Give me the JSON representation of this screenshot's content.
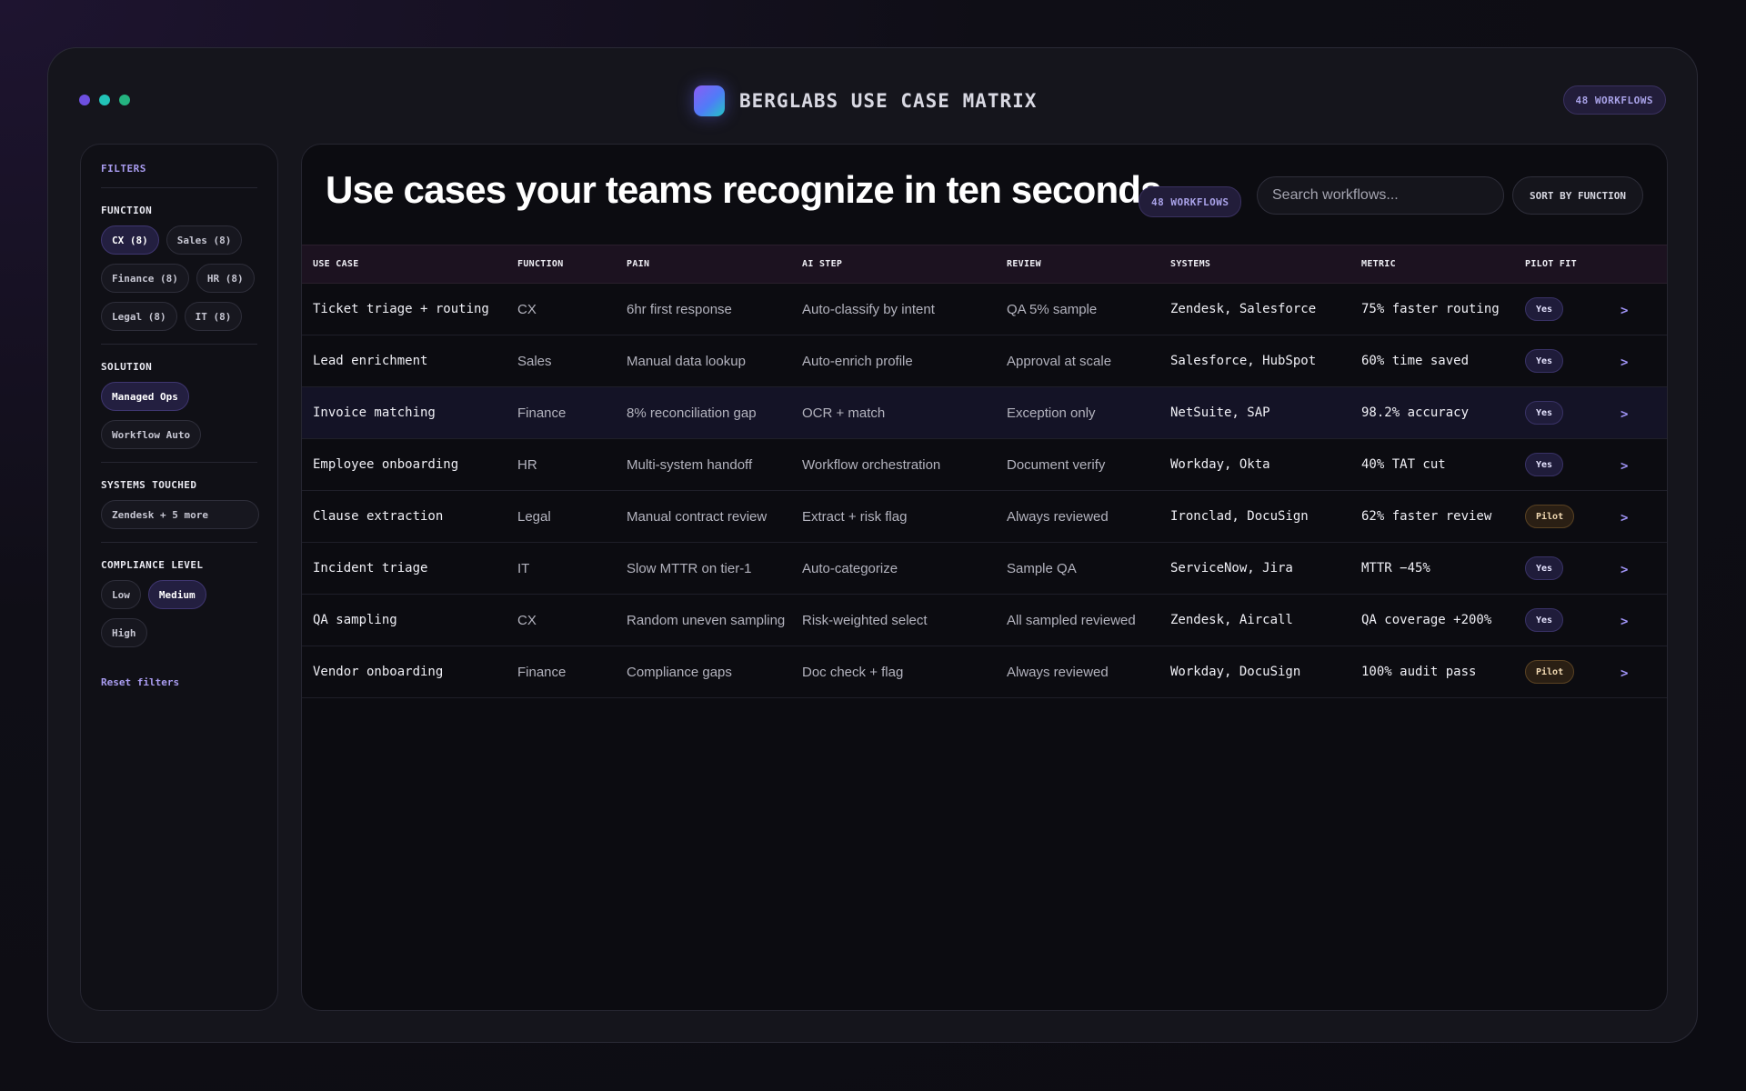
{
  "window": {
    "dots": [
      {
        "name": "window-dot-purple",
        "color": "#6d4fe0"
      },
      {
        "name": "window-dot-teal",
        "color": "#22c3b8"
      },
      {
        "name": "window-dot-green",
        "color": "#24b380"
      }
    ],
    "title": "BERGLABS USE CASE MATRIX",
    "workflow_badge": "48 WORKFLOWS"
  },
  "sidebar": {
    "heading": "FILTERS",
    "sections": {
      "function": {
        "title": "FUNCTION",
        "chips": [
          {
            "label": "CX (8)",
            "active": true
          },
          {
            "label": "Sales (8)",
            "active": false
          },
          {
            "label": "Finance (8)",
            "active": false
          },
          {
            "label": "HR (8)",
            "active": false
          },
          {
            "label": "Legal (8)",
            "active": false
          },
          {
            "label": "IT (8)",
            "active": false
          }
        ]
      },
      "solution": {
        "title": "SOLUTION",
        "chips": [
          {
            "label": "Managed Ops",
            "active": true
          },
          {
            "label": "Workflow Auto",
            "active": false
          }
        ]
      },
      "systems": {
        "title": "SYSTEMS TOUCHED",
        "select_value": "Zendesk + 5 more"
      },
      "compliance": {
        "title": "COMPLIANCE LEVEL",
        "chips": [
          {
            "label": "Low",
            "active": false
          },
          {
            "label": "Medium",
            "active": true
          },
          {
            "label": "High",
            "active": false
          }
        ]
      }
    },
    "reset_label": "Reset filters"
  },
  "main": {
    "headline": "Use cases your teams recognize in ten seconds.",
    "count_badge": "48 WORKFLOWS",
    "search_placeholder": "Search workflows...",
    "sort_label": "SORT BY FUNCTION",
    "columns": [
      "USE CASE",
      "FUNCTION",
      "PAIN",
      "AI STEP",
      "REVIEW",
      "SYSTEMS",
      "METRIC",
      "PILOT FIT"
    ],
    "rows": [
      {
        "use_case": "Ticket triage + routing",
        "function": "CX",
        "pain": "6hr first response",
        "ai_step": "Auto-classify by intent",
        "review": "QA 5% sample",
        "systems": "Zendesk, Salesforce",
        "metric": "75% faster routing",
        "fit": "Yes",
        "arrow": ">"
      },
      {
        "use_case": "Lead enrichment",
        "function": "Sales",
        "pain": "Manual data lookup",
        "ai_step": "Auto-enrich profile",
        "review": "Approval at scale",
        "systems": "Salesforce, HubSpot",
        "metric": "60% time saved",
        "fit": "Yes",
        "arrow": ">"
      },
      {
        "use_case": "Invoice matching",
        "function": "Finance",
        "pain": "8% reconciliation gap",
        "ai_step": "OCR + match",
        "review": "Exception only",
        "systems": "NetSuite, SAP",
        "metric": "98.2% accuracy",
        "fit": "Yes",
        "arrow": ">",
        "highlighted": true
      },
      {
        "use_case": "Employee onboarding",
        "function": "HR",
        "pain": "Multi-system handoff",
        "ai_step": "Workflow orchestration",
        "review": "Document verify",
        "systems": "Workday, Okta",
        "metric": "40% TAT cut",
        "fit": "Yes",
        "arrow": ">"
      },
      {
        "use_case": "Clause extraction",
        "function": "Legal",
        "pain": "Manual contract review",
        "ai_step": "Extract + risk flag",
        "review": "Always reviewed",
        "systems": "Ironclad, DocuSign",
        "metric": "62% faster review",
        "fit": "Pilot",
        "arrow": ">"
      },
      {
        "use_case": "Incident triage",
        "function": "IT",
        "pain": "Slow MTTR on tier-1",
        "ai_step": "Auto-categorize",
        "review": "Sample QA",
        "systems": "ServiceNow, Jira",
        "metric": "MTTR −45%",
        "fit": "Yes",
        "arrow": ">"
      },
      {
        "use_case": "QA sampling",
        "function": "CX",
        "pain": "Random uneven sampling",
        "ai_step": "Risk-weighted select",
        "review": "All sampled reviewed",
        "systems": "Zendesk, Aircall",
        "metric": "QA coverage +200%",
        "fit": "Yes",
        "arrow": ">"
      },
      {
        "use_case": "Vendor onboarding",
        "function": "Finance",
        "pain": "Compliance gaps",
        "ai_step": "Doc check + flag",
        "review": "Always reviewed",
        "systems": "Workday, DocuSign",
        "metric": "100% audit pass",
        "fit": "Pilot",
        "arrow": ">"
      }
    ]
  }
}
